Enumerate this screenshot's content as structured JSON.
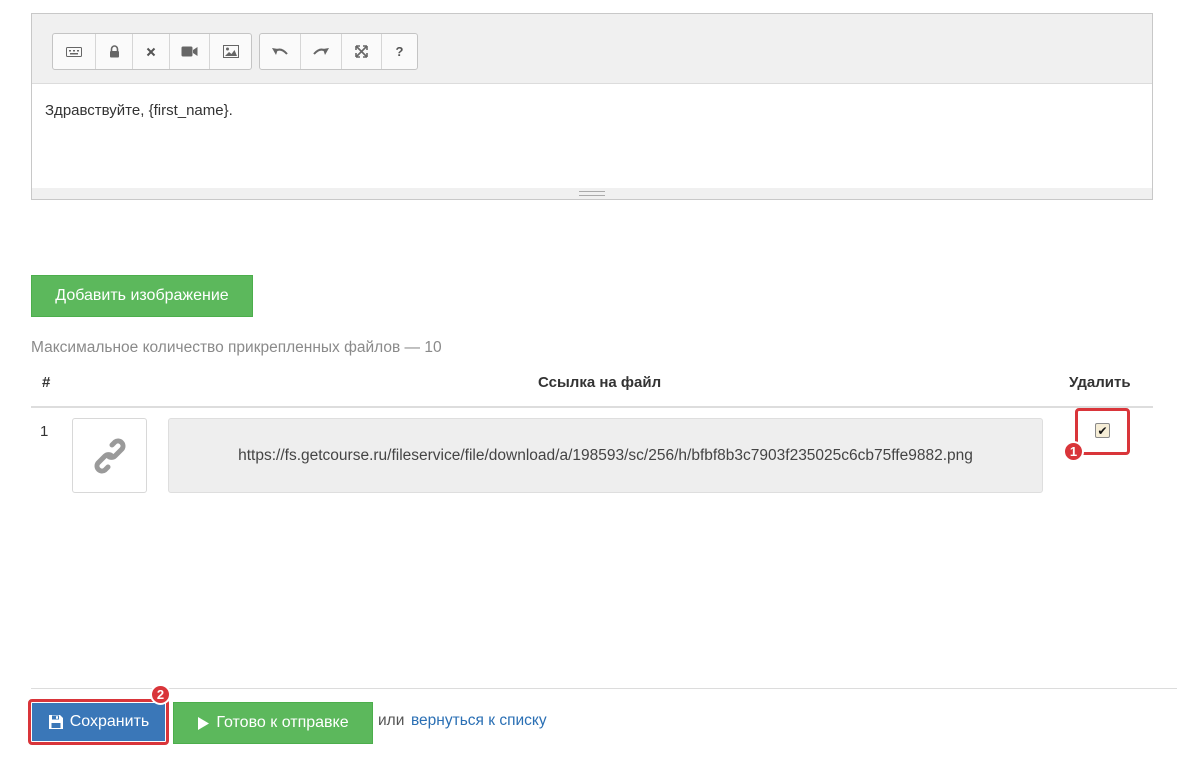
{
  "editor": {
    "toolbar": {
      "group1": [
        {
          "icon": "keyboard-icon"
        },
        {
          "icon": "lock-icon"
        },
        {
          "icon": "close-icon"
        },
        {
          "icon": "video-icon"
        },
        {
          "icon": "image-icon"
        }
      ],
      "group2": [
        {
          "icon": "undo-icon"
        },
        {
          "icon": "redo-icon"
        },
        {
          "icon": "fullscreen-icon"
        },
        {
          "icon": "help-icon",
          "label": "?"
        }
      ]
    },
    "content": "Здравствуйте, {first_name}."
  },
  "attachments": {
    "add_image_label": "Добавить изображение",
    "max_files_text": "Максимальное количество прикрепленных файлов — 10",
    "columns": {
      "num": "#",
      "link": "Ссылка на файл",
      "delete": "Удалить"
    },
    "rows": [
      {
        "num": "1",
        "icon": "link-icon",
        "url": "https://fs.getcourse.ru/fileservice/file/download/a/198593/sc/256/h/bfbf8b3c7903f235025c6cb75ffe9882.png",
        "delete_checked": true
      }
    ]
  },
  "annotations": {
    "badge1": "1",
    "badge2": "2",
    "highlight_color": "#d9353a"
  },
  "footer": {
    "save_label": "Сохранить",
    "ready_label": "Готово к отправке",
    "or_text": "или",
    "back_link": "вернуться к списку"
  },
  "colors": {
    "primary": "#3a77b8",
    "success": "#5cb85c",
    "link": "#2a6fb4"
  }
}
